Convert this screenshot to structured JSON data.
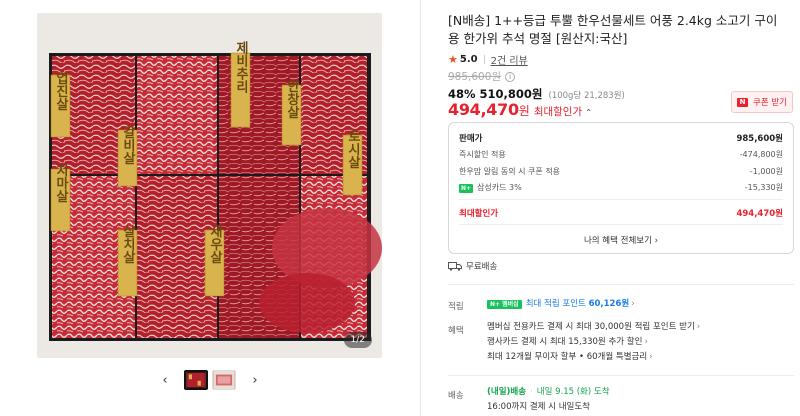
{
  "gallery": {
    "counter": "1/2",
    "prev_icon": "‹",
    "next_icon": "›",
    "photo_labels": [
      "업진살",
      "갈비살",
      "제비추리",
      "안창살",
      "토시살",
      "치마살",
      "살치살",
      "새우살"
    ]
  },
  "product": {
    "title": "[N배송] 1++등급 투뿔 한우선물세트 어풍 2.4kg 소고기 구이용 한가위 추석 명절 [원산지:국산]",
    "rating": "5.0",
    "review_count": "2건 리뷰",
    "original_price": "985,600원",
    "sale_percent": "48%",
    "sale_price": "510,800원",
    "unit_price": "(100g당 21,283원)",
    "max_price": "494,470",
    "max_price_unit": "원",
    "max_label": "최대할인가",
    "max_caret": "⌃",
    "coupon_label": "쿠폰 받기"
  },
  "benefits": {
    "sale_label": "판매가",
    "sale_value": "985,600원",
    "instant_label": "즉시할인 적용",
    "instant_value": "-474,800원",
    "coupon_label": "한우맘 알림 동의 시 쿠폰 적용",
    "coupon_value": "-1,000원",
    "card_badge": "N+",
    "card_label": "삼성카드 3%",
    "card_value": "-15,330원",
    "max_label": "최대할인가",
    "max_value": "494,470원",
    "all_benefits_link": "나의 혜택 전체보기 ›"
  },
  "shipping": {
    "free_label": "무료배송"
  },
  "points": {
    "label": "적립",
    "badge": "N+ 멤버십",
    "text": "최대 적립 포인트",
    "value": "60,126원",
    "arrow": "›"
  },
  "perks": {
    "label": "혜택",
    "line1": "멤버십 전용카드 결제 시 최대 30,000원 적립 포인트 받기",
    "line2": "행사카드 결제 시 최대 15,330원 추가 할인",
    "line3": "최대 12개월 무이자 할부 • 60개월 특별금리",
    "arrow": "›"
  },
  "delivery": {
    "label": "배송",
    "tag": "(내일)배송",
    "dot": "·",
    "eta": "내일 9.15 (화) 도착",
    "note": "16:00까지 결제 시 내일도착"
  },
  "colors": {
    "accent_red": "#e8212e",
    "npay_green": "#19c35c",
    "star_orange": "#f04f23"
  }
}
